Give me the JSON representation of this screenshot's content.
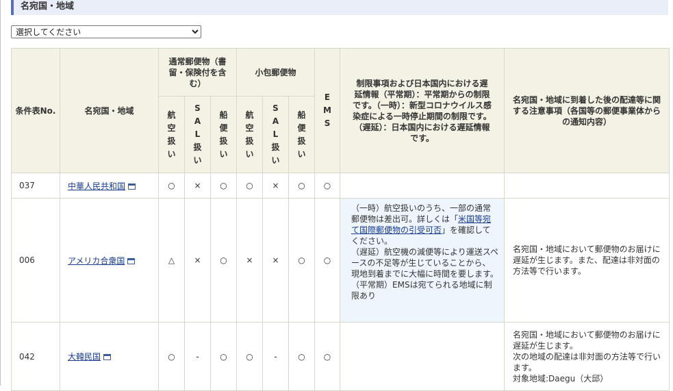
{
  "section": {
    "title": "名宛国・地域"
  },
  "select": {
    "value": "選択してください"
  },
  "table": {
    "headers": {
      "code": "条件表No.",
      "country": "名宛国・地域",
      "normal_mail": "通常郵便物（書留・保険付を含む）",
      "small_packet": "小包郵便物",
      "air": "航空扱い",
      "sal": "SAL扱い",
      "ship": "船便扱い",
      "ems": "EMS",
      "restrictions": "制限事項および日本国内における遅延情報（平常期）：平常期からの制限です。（一時）：新型コロナウイルス感染症による一時停止期間の制限です。（遅延）：日本国内における遅延情報です。",
      "notices": "名宛国・地域に到着した後の配達等に関する注意事項（各国等の郵便事業体からの通知内容）"
    },
    "rows": [
      {
        "code": "037",
        "country": "中華人民共和国",
        "marks": [
          "○",
          "×",
          "○",
          "○",
          "×",
          "○",
          "○"
        ],
        "restrict_pre": "",
        "restrict_link": "",
        "restrict_post": "",
        "notice": ""
      },
      {
        "code": "006",
        "country": "アメリカ合衆国",
        "marks": [
          "△",
          "×",
          "○",
          "×",
          "×",
          "○",
          "○"
        ],
        "restrict_pre": "（一時）航空扱いのうち、一部の通常郵便物は差出可。詳しくは「",
        "restrict_link": "米国等宛て国際郵便物の引受可否",
        "restrict_post": "」を確認してください。\n（遅延）航空機の減便等により運送スペースの不足等が生じていることから、現地到着までに大幅に時間を要します。\n（平常期）EMSは宛てられる地域に制限あり",
        "notice": "名宛国・地域において郵便物のお届けに遅延が生じます。また、配達は非対面の方法等で行います。"
      },
      {
        "code": "042",
        "country": "大韓民国",
        "marks": [
          "○",
          "-",
          "○",
          "○",
          "-",
          "○",
          "○"
        ],
        "restrict_pre": "",
        "restrict_link": "",
        "restrict_post": "",
        "notice": "名宛国・地域において郵便物のお届けに遅延が生じます。\n次の地域の配達は非対面の方法等で行います。\n対象地域:Daegu（大邱）"
      }
    ]
  }
}
